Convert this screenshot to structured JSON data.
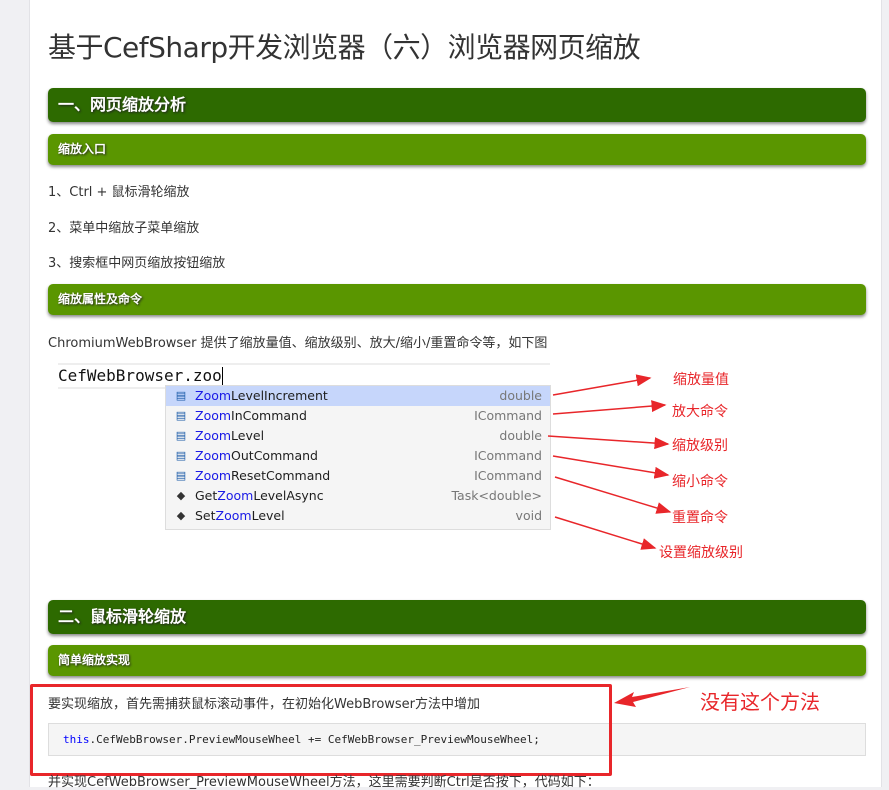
{
  "title": "基于CefSharp开发浏览器（六）浏览器网页缩放",
  "section1": {
    "heading": "一、网页缩放分析",
    "sub1": "缩放入口",
    "items": [
      "1、Ctrl + 鼠标滑轮缩放",
      "2、菜单中缩放子菜单缩放",
      "3、搜索框中网页缩放按钮缩放"
    ],
    "sub2": "缩放属性及命令",
    "desc": "ChromiumWebBrowser 提供了缩放量值、缩放级别、放大/缩小/重置命令等，如下图",
    "editor_text": "CefWebBrowser.zoo",
    "completions": [
      {
        "prefix": "",
        "match": "Zoom",
        "rest": "LevelIncrement",
        "type": "double",
        "icon": "property-icon"
      },
      {
        "prefix": "",
        "match": "Zoom",
        "rest": "InCommand",
        "type": "ICommand",
        "icon": "property-icon"
      },
      {
        "prefix": "",
        "match": "Zoom",
        "rest": "Level",
        "type": "double",
        "icon": "property-icon"
      },
      {
        "prefix": "",
        "match": "Zoom",
        "rest": "OutCommand",
        "type": "ICommand",
        "icon": "property-icon"
      },
      {
        "prefix": "",
        "match": "Zoom",
        "rest": "ResetCommand",
        "type": "ICommand",
        "icon": "property-icon"
      },
      {
        "prefix": "Get",
        "match": "Zoom",
        "rest": "LevelAsync",
        "type": "Task<double>",
        "icon": "method-icon"
      },
      {
        "prefix": "Set",
        "match": "Zoom",
        "rest": "Level",
        "type": "void",
        "icon": "method-icon"
      }
    ],
    "annotations": [
      "缩放量值",
      "放大命令",
      "缩放级别",
      "缩小命令",
      "重置命令",
      "设置缩放级别"
    ]
  },
  "section2": {
    "heading": "二、鼠标滑轮缩放",
    "sub1": "简单缩放实现",
    "p1": "要实现缩放，首先需捕获鼠标滚动事件，在初始化WebBrowser方法中增加",
    "code_kw": "this",
    "code_rest": ".CefWebBrowser.PreviewMouseWheel += CefWebBrowser_PreviewMouseWheel;",
    "annotation": "没有这个方法",
    "p2": "并实现CefWebBrowser_PreviewMouseWheel方法，这里需要判断Ctrl是否按下，代码如下："
  },
  "colors": {
    "h2": "#2d6a00",
    "h3": "#5a9600",
    "annotation": "#e8262a"
  }
}
